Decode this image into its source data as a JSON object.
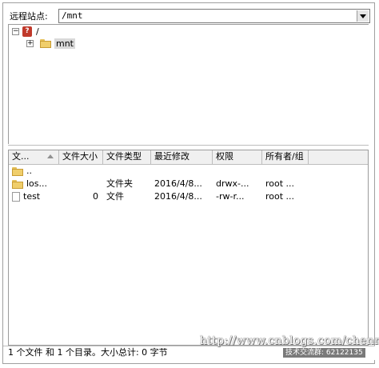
{
  "remote_site": {
    "label": "远程站点:",
    "path": "/mnt"
  },
  "tree": {
    "root_label": "/",
    "child_label": "mnt",
    "root_expander": "−",
    "child_expander": "+"
  },
  "list": {
    "headers": [
      "文...",
      "文件大小",
      "文件类型",
      "最近修改",
      "权限",
      "所有者/组"
    ],
    "rows": [
      {
        "name": "..",
        "size": "",
        "type": "",
        "modified": "",
        "perms": "",
        "owner": "",
        "icon": "folder-icon"
      },
      {
        "name": "los...",
        "size": "",
        "type": "文件夹",
        "modified": "2016/4/8...",
        "perms": "drwx-...",
        "owner": "root ...",
        "icon": "folder-icon"
      },
      {
        "name": "test",
        "size": "0",
        "type": "文件",
        "modified": "2016/4/8...",
        "perms": "-rw-r...",
        "owner": "root ...",
        "icon": "file-icon"
      }
    ]
  },
  "status": {
    "text": "1 个文件 和 1 个目录。大小总计: 0 字节"
  },
  "watermark": {
    "url": "http://www.cnblogs.com/chenmh",
    "sub": "技术交流群: 62122135"
  },
  "colors": {
    "header_bg": "#f0f0f0",
    "selected_bg": "#d9d9d9",
    "folder": "#f0ce6b"
  }
}
